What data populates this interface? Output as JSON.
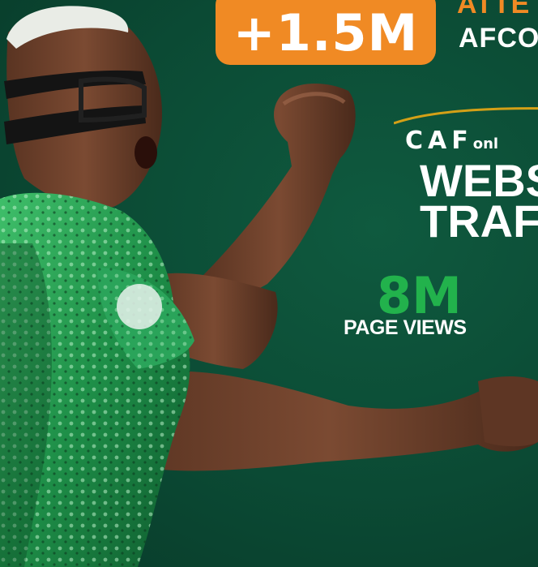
{
  "badge": {
    "text": "+1.5M"
  },
  "headline": {
    "line1": "ATTE",
    "line2": "AFCO"
  },
  "logo": {
    "main": "CAF",
    "suffix": "onl"
  },
  "title": {
    "line1": "WEBS",
    "line2": "TRAFF"
  },
  "stat": {
    "value": "8M",
    "label": "PAGE VIEWS"
  },
  "colors": {
    "background": "#0b4a34",
    "accent_orange": "#f08a24",
    "accent_green": "#22b24c",
    "text_white": "#ffffff"
  }
}
